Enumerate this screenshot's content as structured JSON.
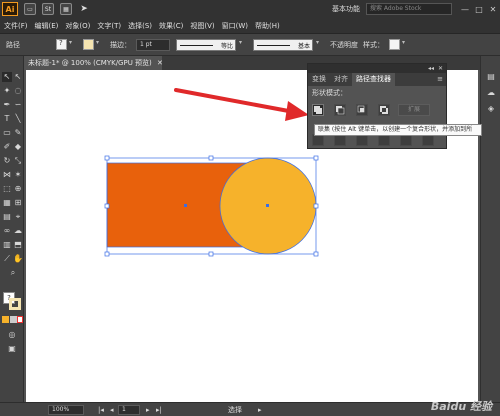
{
  "titlebar": {
    "logo": "Ai",
    "icon_st": "St",
    "workspace": "基本功能",
    "search_placeholder": "搜索 Adobe Stock",
    "minimize": "—",
    "maximize": "□",
    "close": "✕"
  },
  "menu": [
    "文件(F)",
    "编辑(E)",
    "对象(O)",
    "文字(T)",
    "选择(S)",
    "效果(C)",
    "视图(V)",
    "窗口(W)",
    "帮助(H)"
  ],
  "controlbar": {
    "path_label": "路径",
    "stroke_label": "描边：",
    "stroke_value": "1 pt",
    "profile_label": "等比",
    "brush_label": "基本",
    "opacity_label": "不透明度",
    "style_label": "样式："
  },
  "document": {
    "tab_label": "未标题-1* @ 100% (CMYK/GPU 预览)"
  },
  "pathfinder": {
    "tabs": [
      "变换",
      "对齐",
      "路径查找器"
    ],
    "active_tab": "路径查找器",
    "shape_modes_label": "形状模式：",
    "expand_label": "扩展",
    "tooltip": "联集 (按住 Alt 键单击，以创建一个复合形状，并添加到所"
  },
  "status": {
    "zoom": "100%",
    "page": "1",
    "selection": "选择"
  },
  "watermark": "Baidu 经验",
  "colors": {
    "rectangle_fill": "#e8610c",
    "circle_fill": "#f6b22b",
    "selection": "#3b6de6",
    "arrow": "#e0292a",
    "canvas": "#ffffff",
    "ui_dark": "#323232",
    "ui_mid": "#434343"
  }
}
